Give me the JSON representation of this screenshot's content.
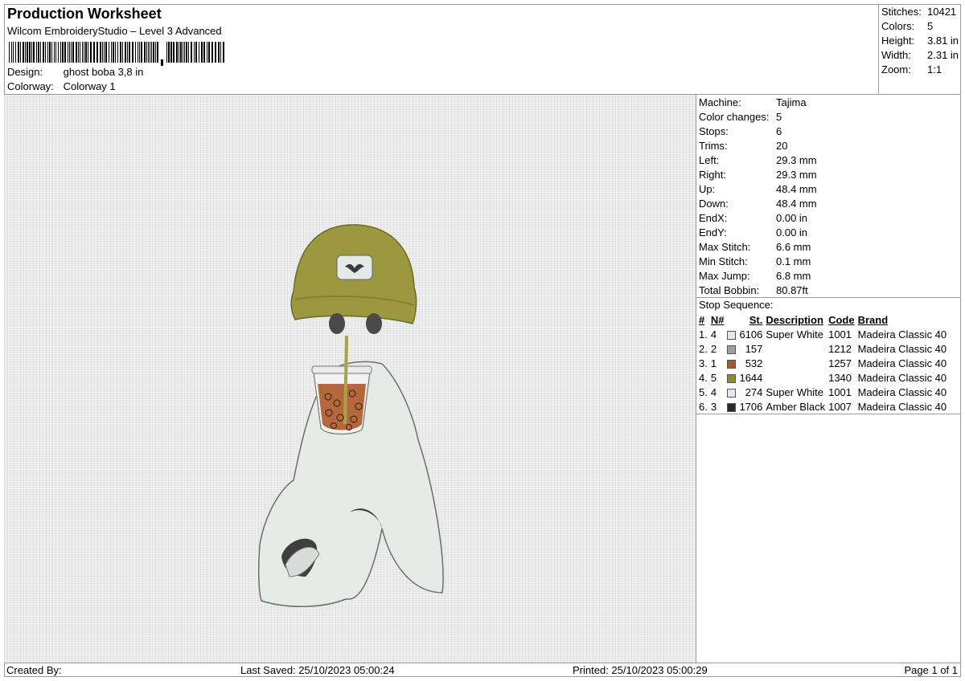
{
  "header": {
    "title": "Production Worksheet",
    "software": "Wilcom EmbroideryStudio – Level 3 Advanced",
    "design_label": "Design:",
    "design_value": "ghost boba 3,8 in",
    "colorway_label": "Colorway:",
    "colorway_value": "Colorway 1"
  },
  "stats": [
    {
      "label": "Stitches:",
      "value": "10421"
    },
    {
      "label": "Colors:",
      "value": "5"
    },
    {
      "label": "Height:",
      "value": "3.81 in"
    },
    {
      "label": "Width:",
      "value": "2.31 in"
    },
    {
      "label": "Zoom:",
      "value": "1:1"
    }
  ],
  "machine": [
    {
      "label": "Machine:",
      "value": "Tajima"
    },
    {
      "label": "Color changes:",
      "value": "5"
    },
    {
      "label": "Stops:",
      "value": "6"
    },
    {
      "label": "Trims:",
      "value": "20"
    },
    {
      "label": "Left:",
      "value": "29.3 mm"
    },
    {
      "label": "Right:",
      "value": "29.3 mm"
    },
    {
      "label": "Up:",
      "value": "48.4 mm"
    },
    {
      "label": "Down:",
      "value": "48.4 mm"
    },
    {
      "label": "EndX:",
      "value": "0.00 in"
    },
    {
      "label": "EndY:",
      "value": "0.00 in"
    },
    {
      "label": "Max Stitch:",
      "value": "6.6 mm"
    },
    {
      "label": "Min Stitch:",
      "value": "0.1 mm"
    },
    {
      "label": "Max Jump:",
      "value": "6.8 mm"
    },
    {
      "label": "Total Bobbin:",
      "value": "80.87ft"
    }
  ],
  "stop_sequence": {
    "title": "Stop Sequence:",
    "headers": [
      "#",
      "N#",
      "St.",
      "Description",
      "Code",
      "Brand"
    ],
    "rows": [
      {
        "idx": "1.",
        "n": "4",
        "color": "#e4e8f6",
        "st": "6106",
        "desc": "Super White",
        "code": "1001",
        "brand": "Madeira Classic 40"
      },
      {
        "idx": "2.",
        "n": "2",
        "color": "#9aa3a1",
        "st": "157",
        "desc": "",
        "code": "1212",
        "brand": "Madeira Classic 40"
      },
      {
        "idx": "3.",
        "n": "1",
        "color": "#a85a2e",
        "st": "532",
        "desc": "",
        "code": "1257",
        "brand": "Madeira Classic 40"
      },
      {
        "idx": "4.",
        "n": "5",
        "color": "#8e8a2e",
        "st": "1644",
        "desc": "",
        "code": "1340",
        "brand": "Madeira Classic 40"
      },
      {
        "idx": "5.",
        "n": "4",
        "color": "#e4e8f6",
        "st": "274",
        "desc": "Super White",
        "code": "1001",
        "brand": "Madeira Classic 40"
      },
      {
        "idx": "6.",
        "n": "3",
        "color": "#2a2a2a",
        "st": "1706",
        "desc": "Amber Black",
        "code": "1007",
        "brand": "Madeira Classic 40"
      }
    ]
  },
  "footer": {
    "created_by": "Created By:",
    "last_saved": "Last Saved: 25/10/2023 05:00:24",
    "printed": "Printed: 25/10/2023 05:00:29",
    "page": "Page 1 of 1"
  }
}
